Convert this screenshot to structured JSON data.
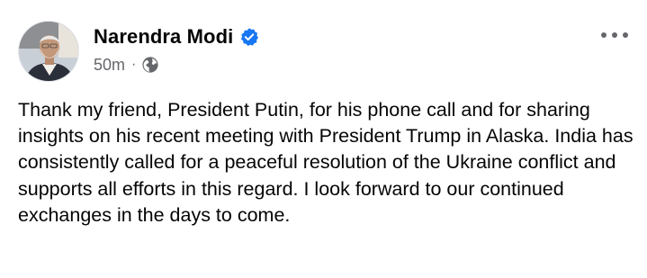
{
  "post": {
    "author": {
      "name": "Narendra Modi",
      "verified": true,
      "avatar_icon": "profile-photo"
    },
    "meta": {
      "timestamp": "50m",
      "separator": "·",
      "audience_icon": "globe-icon"
    },
    "more_icon": "more-horizontal-icon",
    "text": "Thank my friend, President Putin, for his phone call and for sharing insights on his recent meeting with President Trump in Alaska. India has consistently called for a peaceful resolution of the Ukraine conflict and supports all efforts in this regard. I look forward to our continued exchanges in the days to come."
  },
  "colors": {
    "text_primary": "#050505",
    "text_secondary": "#65676b",
    "verified_blue": "#1877f2",
    "background": "#ffffff"
  }
}
